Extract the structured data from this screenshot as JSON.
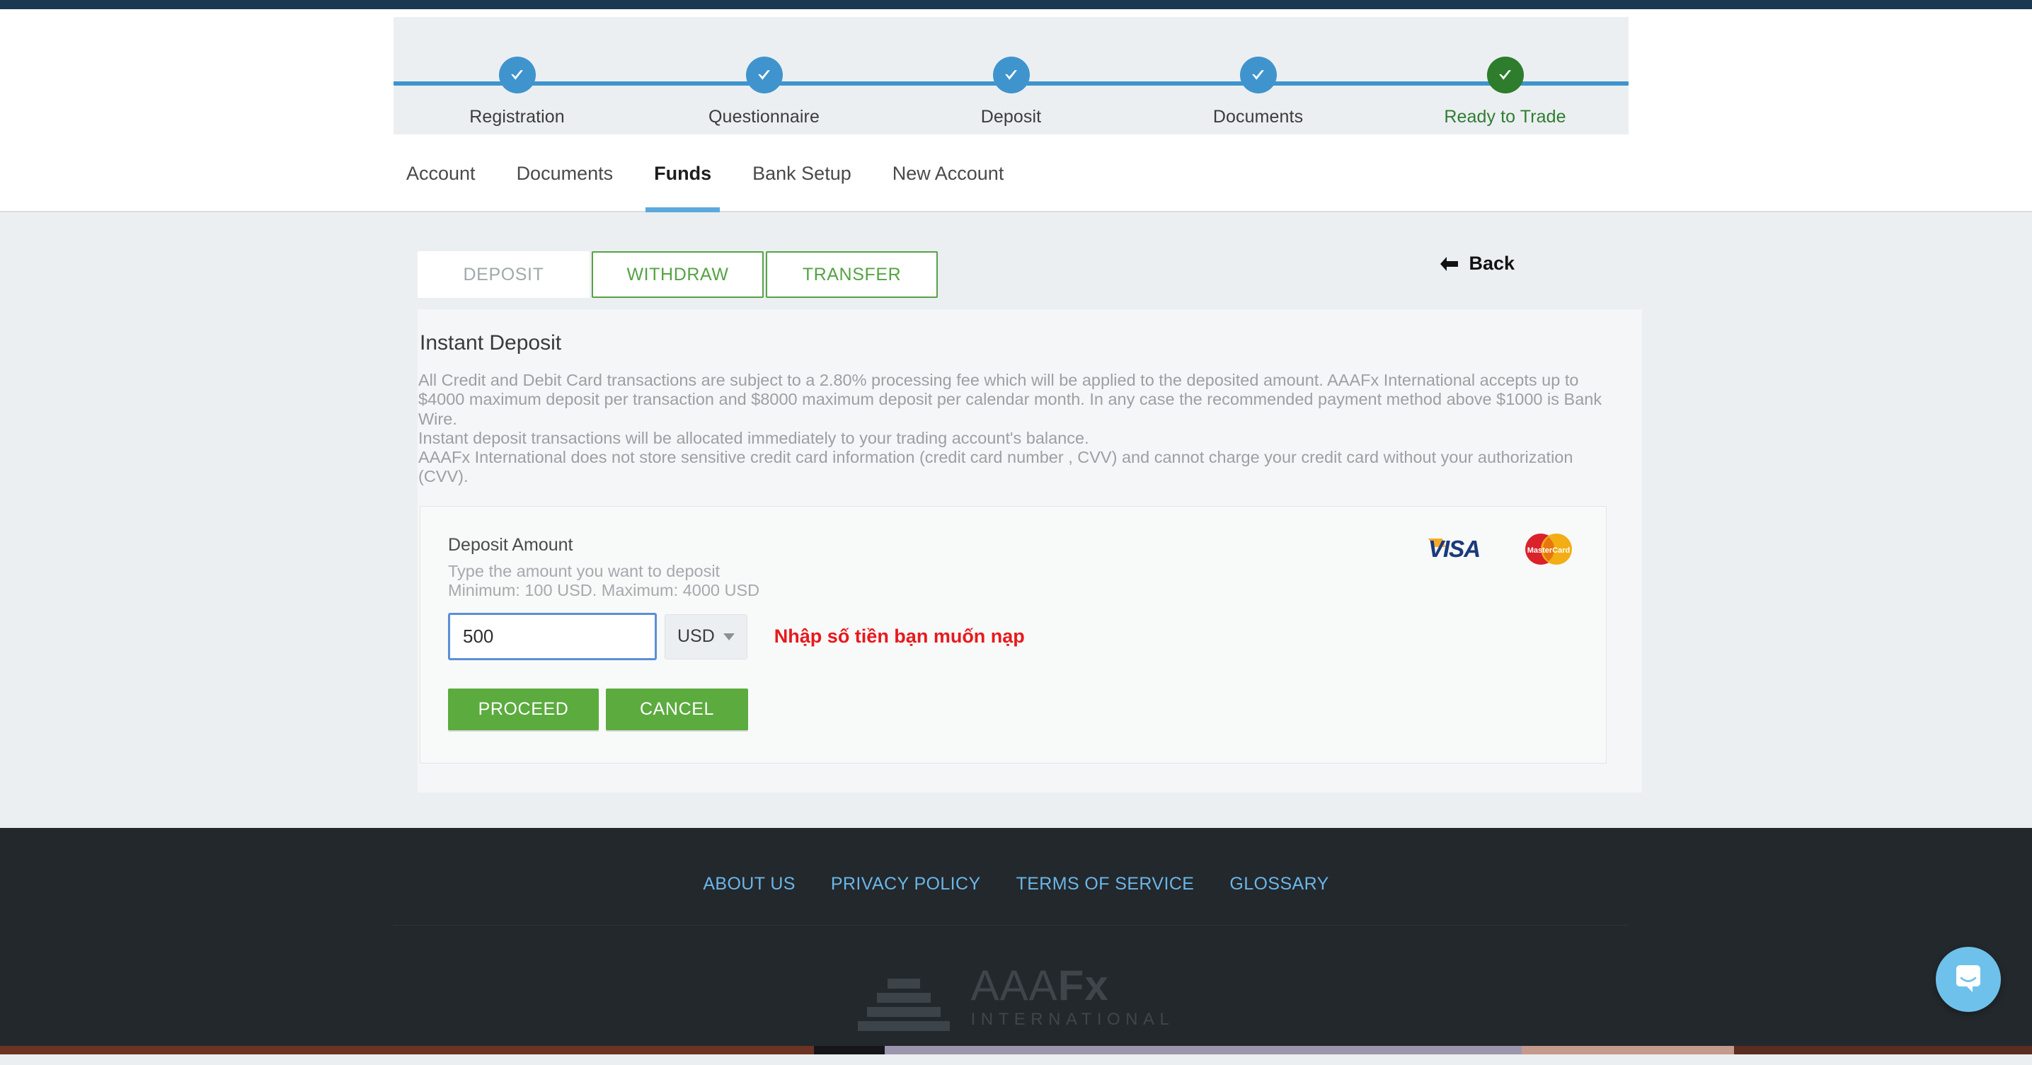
{
  "stepper": {
    "steps": [
      {
        "label": "Registration",
        "state": "complete"
      },
      {
        "label": "Questionnaire",
        "state": "complete"
      },
      {
        "label": "Deposit",
        "state": "complete"
      },
      {
        "label": "Documents",
        "state": "complete"
      },
      {
        "label": "Ready to Trade",
        "state": "final"
      }
    ],
    "colors": {
      "active": "#3f94ce",
      "final": "#2d7d2d",
      "line": "#3f94ce"
    }
  },
  "nav": {
    "tabs": [
      {
        "label": "Account",
        "active": false
      },
      {
        "label": "Documents",
        "active": false
      },
      {
        "label": "Funds",
        "active": true
      },
      {
        "label": "Bank Setup",
        "active": false
      },
      {
        "label": "New Account",
        "active": false
      }
    ],
    "active_underline_color": "#5aa9dd"
  },
  "funds": {
    "segments": [
      {
        "label": "DEPOSIT",
        "active": true
      },
      {
        "label": "WITHDRAW",
        "active": false
      },
      {
        "label": "TRANSFER",
        "active": false
      }
    ],
    "back_label": "Back",
    "panel_title": "Instant Deposit",
    "panel_paragraphs": [
      "All Credit and Debit Card transactions are subject to a 2.80% processing fee which will be applied to the deposited amount. AAAFx International accepts up to $4000 maximum deposit per transaction and $8000 maximum deposit per calendar month. In any case the recommended payment method above $1000 is Bank Wire.",
      "Instant deposit transactions will be allocated immediately to your trading account's balance.",
      "AAAFx International does not store sensitive credit card information (credit card number , CVV) and cannot charge your credit card without your authorization (CVV)."
    ],
    "form": {
      "label": "Deposit Amount",
      "hint_line1": "Type the amount you want to deposit",
      "hint_line2": "Minimum: 100 USD. Maximum: 4000 USD",
      "amount_value": "500",
      "amount_placeholder": "",
      "currency": "USD",
      "annotation": "Nhập số tiền bạn muốn nạp",
      "annotation_color": "#e8191c",
      "proceed_label": "PROCEED",
      "cancel_label": "CANCEL",
      "accepted_cards": [
        "VISA",
        "MasterCard"
      ]
    }
  },
  "footer": {
    "links": [
      "ABOUT US",
      "PRIVACY POLICY",
      "TERMS OF SERVICE",
      "GLOSSARY"
    ],
    "link_color": "#6ab6e8",
    "brand_name": "AAAFx",
    "brand_sub": "INTERNATIONAL"
  },
  "chat": {
    "icon": "chat-bubble-icon",
    "color": "#6ec1ea"
  }
}
